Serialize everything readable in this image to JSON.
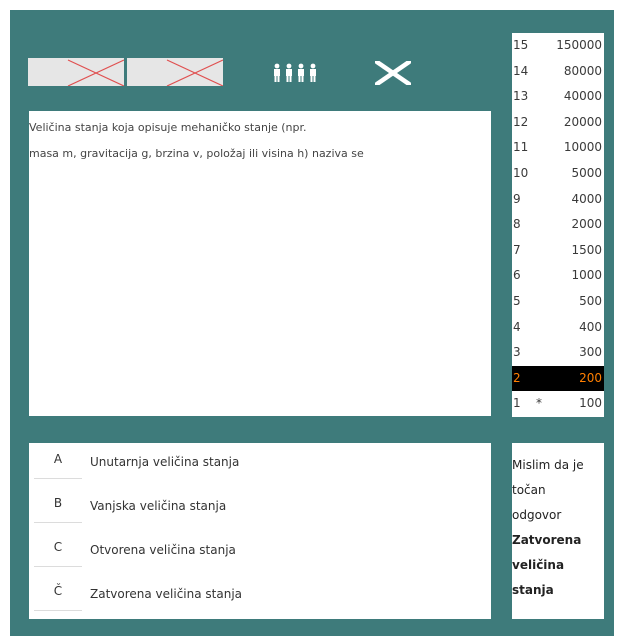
{
  "lifelines": {
    "fifty_fifty": "used-joker",
    "phone": "used-joker",
    "audience": "audience-icon",
    "quit": "close-icon"
  },
  "question": {
    "line1": "Veličina stanja koja opisuje mehaničko stanje (npr.",
    "line2": "masa m, gravitacija g, brzina v, položaj ili visina h) naziva se"
  },
  "prize_ladder": [
    {
      "level": "15",
      "safe": "",
      "amount": "150000"
    },
    {
      "level": "14",
      "safe": "",
      "amount": "80000"
    },
    {
      "level": "13",
      "safe": "",
      "amount": "40000"
    },
    {
      "level": "12",
      "safe": "",
      "amount": "20000"
    },
    {
      "level": "11",
      "safe": "",
      "amount": "10000"
    },
    {
      "level": "10",
      "safe": "",
      "amount": "5000"
    },
    {
      "level": "9",
      "safe": "",
      "amount": "4000"
    },
    {
      "level": "8",
      "safe": "",
      "amount": "2000"
    },
    {
      "level": "7",
      "safe": "",
      "amount": "1500"
    },
    {
      "level": "6",
      "safe": "",
      "amount": "1000"
    },
    {
      "level": "5",
      "safe": "",
      "amount": "500"
    },
    {
      "level": "4",
      "safe": "",
      "amount": "400"
    },
    {
      "level": "3",
      "safe": "",
      "amount": "300"
    },
    {
      "level": "2",
      "safe": "",
      "amount": "200"
    },
    {
      "level": "1",
      "safe": "*",
      "amount": "100"
    }
  ],
  "current_level": "2",
  "answers": [
    {
      "letter": "A",
      "text": "Unutarnja veličina stanja"
    },
    {
      "letter": "B",
      "text": "Vanjska veličina stanja"
    },
    {
      "letter": "C",
      "text": "Otvorena veličina stanja"
    },
    {
      "letter": "Č",
      "text": "Zatvorena veličina stanja"
    }
  ],
  "hint": {
    "line1": "Mislim da je",
    "line2": "točan",
    "line3": "odgovor",
    "answer_line1": "Zatvorena",
    "answer_line2": "veličina",
    "answer_line3": "stanja"
  },
  "colors": {
    "background": "#3e7b7b",
    "panel": "#ffffff",
    "current_row_bg": "#000000",
    "current_row_text": "#ff7f00",
    "joker_cross": "#e05050"
  }
}
